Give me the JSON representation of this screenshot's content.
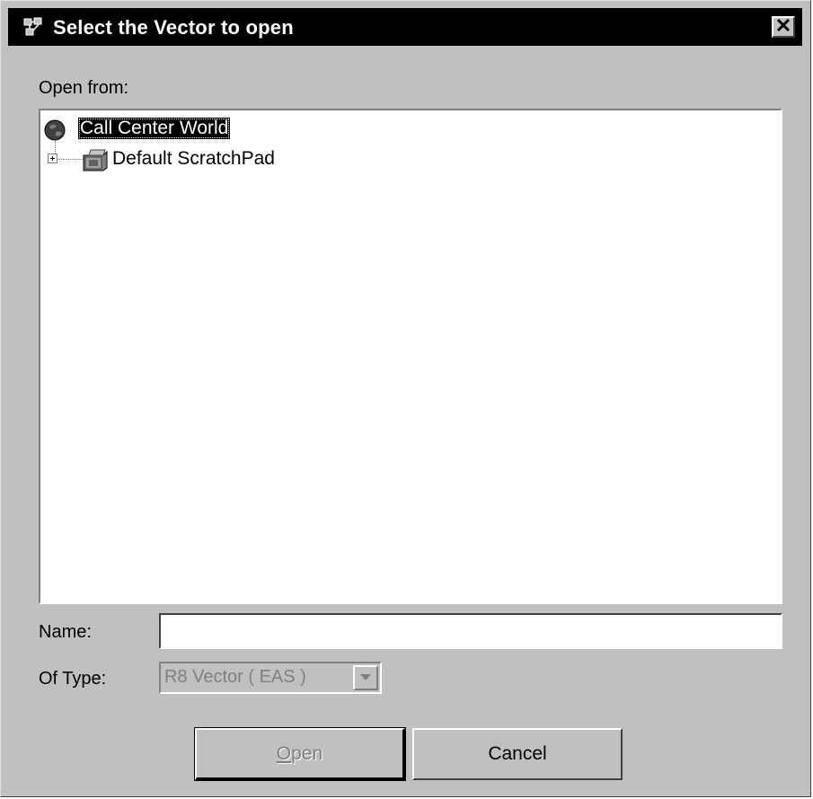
{
  "window": {
    "title": "Select the Vector to open",
    "close_glyph": "✕"
  },
  "open_from_label": "Open from:",
  "tree": {
    "root": {
      "label": "Call Center World",
      "icon": "globe-icon"
    },
    "children": [
      {
        "label": "Default ScratchPad",
        "icon": "scratchpad-icon",
        "expanded": false
      }
    ]
  },
  "name": {
    "label": "Name:",
    "value": ""
  },
  "of_type": {
    "label": "Of Type:",
    "value": "R8 Vector ( EAS )"
  },
  "buttons": {
    "open_mnemonic": "O",
    "open_rest": "pen",
    "cancel": "Cancel"
  }
}
